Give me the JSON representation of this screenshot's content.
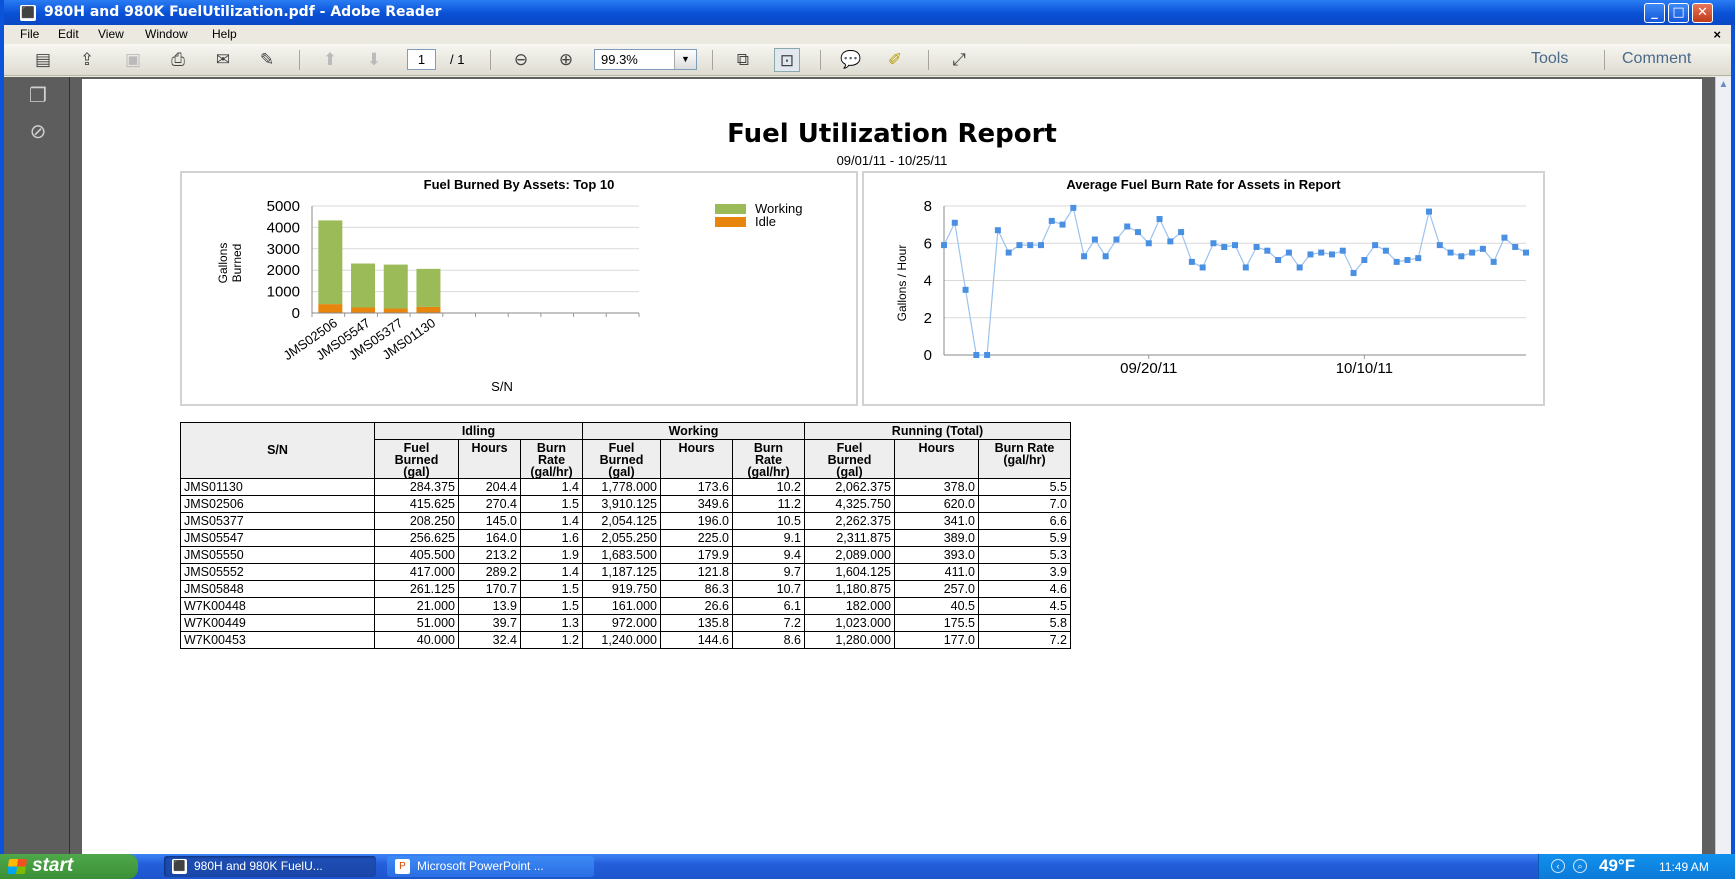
{
  "window": {
    "title": "980H and 980K FuelUtilization.pdf - Adobe Reader",
    "minimize": "_",
    "maximize": "□",
    "close": "✕"
  },
  "menu": {
    "items": [
      "File",
      "Edit",
      "View",
      "Window",
      "Help"
    ],
    "close_doc": "×"
  },
  "toolbar": {
    "page_current": "1",
    "page_total": "/ 1",
    "zoom": "99.3%",
    "tools_label": "Tools",
    "comment_label": "Comment"
  },
  "report": {
    "title": "Fuel Utilization Report",
    "date_range": "09/01/11 - 10/25/11"
  },
  "chart_data": [
    {
      "type": "bar",
      "title": "Fuel Burned By Assets: Top 10",
      "xlabel": "S/N",
      "ylabel": "Gallons Burned",
      "ylabel_lines": [
        "Gallons",
        "Burned"
      ],
      "ylim": [
        0,
        5000
      ],
      "yticks": [
        "5000",
        "4000",
        "3000",
        "2000",
        "1000",
        "0"
      ],
      "yticks_values": [
        5000,
        4000,
        3000,
        2000,
        1000,
        0
      ],
      "categories": [
        "JMS02506",
        "JMS05547",
        "JMS05377",
        "JMS01130"
      ],
      "stacked": true,
      "series": [
        {
          "name": "Idle",
          "values": [
            415.625,
            256.625,
            208.25,
            284.375
          ],
          "color": "#e8850c"
        },
        {
          "name": "Working",
          "values": [
            3910.125,
            2055.25,
            2054.125,
            1778.0
          ],
          "color": "#9bbb59"
        }
      ],
      "legend": [
        "Working",
        "Idle"
      ],
      "legend_position": "top-right",
      "grid": true
    },
    {
      "type": "line",
      "title": "Average Fuel Burn Rate for Assets in Report",
      "ylabel": "Gallons / Hour",
      "ylim": [
        0,
        8
      ],
      "yticks": [
        "8",
        "6",
        "4",
        "2",
        "0"
      ],
      "yticks_values": [
        8,
        6,
        4,
        2,
        0
      ],
      "xlim": [
        "09/01/11",
        "10/25/11"
      ],
      "xticks": [
        "09/20/11",
        "10/10/11"
      ],
      "color": "#4a90e2",
      "grid": true,
      "series": [
        {
          "x": [
            "09/01/11",
            "09/02/11",
            "09/03/11",
            "09/04/11",
            "09/05/11",
            "09/06/11",
            "09/07/11",
            "09/08/11",
            "09/09/11",
            "09/10/11",
            "09/11/11",
            "09/12/11",
            "09/13/11",
            "09/14/11",
            "09/15/11",
            "09/16/11",
            "09/17/11",
            "09/18/11",
            "09/19/11",
            "09/20/11",
            "09/21/11",
            "09/22/11",
            "09/23/11",
            "09/24/11",
            "09/25/11",
            "09/26/11",
            "09/27/11",
            "09/28/11",
            "09/29/11",
            "09/30/11",
            "10/01/11",
            "10/02/11",
            "10/03/11",
            "10/04/11",
            "10/05/11",
            "10/06/11",
            "10/07/11",
            "10/08/11",
            "10/09/11",
            "10/10/11",
            "10/11/11",
            "10/12/11",
            "10/13/11",
            "10/14/11",
            "10/15/11",
            "10/16/11",
            "10/17/11",
            "10/18/11",
            "10/19/11",
            "10/20/11",
            "10/21/11",
            "10/22/11",
            "10/23/11",
            "10/24/11",
            "10/25/11"
          ],
          "values": [
            5.9,
            7.1,
            3.5,
            0,
            0,
            6.7,
            5.5,
            5.9,
            5.9,
            5.9,
            7.2,
            7.0,
            7.9,
            5.3,
            6.2,
            5.3,
            6.2,
            6.9,
            6.6,
            6.0,
            7.3,
            6.1,
            6.6,
            5.0,
            4.7,
            6.0,
            5.8,
            5.9,
            4.7,
            5.8,
            5.6,
            5.1,
            5.5,
            4.7,
            5.4,
            5.5,
            5.4,
            5.6,
            4.4,
            5.1,
            5.9,
            5.6,
            5.0,
            5.1,
            5.2,
            7.7,
            5.9,
            5.5,
            5.3,
            5.5,
            5.7,
            5.0,
            6.3,
            5.8,
            5.5
          ]
        }
      ]
    }
  ],
  "table": {
    "sn_header": "S/N",
    "groups": [
      "Idling",
      "Working",
      "Running (Total)"
    ],
    "sub_headers": [
      [
        "Fuel",
        "Burned",
        "(gal)"
      ],
      [
        "Hours"
      ],
      [
        "Burn",
        "Rate",
        "(gal/hr)"
      ],
      [
        "Fuel",
        "Burned",
        "(gal)"
      ],
      [
        "Hours"
      ],
      [
        "Burn",
        "Rate",
        "(gal/hr)"
      ],
      [
        "Fuel",
        "Burned",
        "(gal)"
      ],
      [
        "Hours"
      ],
      [
        "Burn Rate",
        "(gal/hr)"
      ]
    ],
    "rows": [
      [
        "JMS01130",
        "284.375",
        "204.4",
        "1.4",
        "1,778.000",
        "173.6",
        "10.2",
        "2,062.375",
        "378.0",
        "5.5"
      ],
      [
        "JMS02506",
        "415.625",
        "270.4",
        "1.5",
        "3,910.125",
        "349.6",
        "11.2",
        "4,325.750",
        "620.0",
        "7.0"
      ],
      [
        "JMS05377",
        "208.250",
        "145.0",
        "1.4",
        "2,054.125",
        "196.0",
        "10.5",
        "2,262.375",
        "341.0",
        "6.6"
      ],
      [
        "JMS05547",
        "256.625",
        "164.0",
        "1.6",
        "2,055.250",
        "225.0",
        "9.1",
        "2,311.875",
        "389.0",
        "5.9"
      ],
      [
        "JMS05550",
        "405.500",
        "213.2",
        "1.9",
        "1,683.500",
        "179.9",
        "9.4",
        "2,089.000",
        "393.0",
        "5.3"
      ],
      [
        "JMS05552",
        "417.000",
        "289.2",
        "1.4",
        "1,187.125",
        "121.8",
        "9.7",
        "1,604.125",
        "411.0",
        "3.9"
      ],
      [
        "JMS05848",
        "261.125",
        "170.7",
        "1.5",
        "919.750",
        "86.3",
        "10.7",
        "1,180.875",
        "257.0",
        "4.6"
      ],
      [
        "W7K00448",
        "21.000",
        "13.9",
        "1.5",
        "161.000",
        "26.6",
        "6.1",
        "182.000",
        "40.5",
        "4.5"
      ],
      [
        "W7K00449",
        "51.000",
        "39.7",
        "1.3",
        "972.000",
        "135.8",
        "7.2",
        "1,023.000",
        "175.5",
        "5.8"
      ],
      [
        "W7K00453",
        "40.000",
        "32.4",
        "1.2",
        "1,240.000",
        "144.6",
        "8.6",
        "1,280.000",
        "177.0",
        "7.2"
      ]
    ]
  },
  "taskbar": {
    "start_label": "start",
    "tasks": [
      {
        "label": "980H and 980K FuelU..."
      },
      {
        "label": "Microsoft PowerPoint ..."
      }
    ],
    "temperature": "49°F",
    "clock": "11:49 AM"
  }
}
